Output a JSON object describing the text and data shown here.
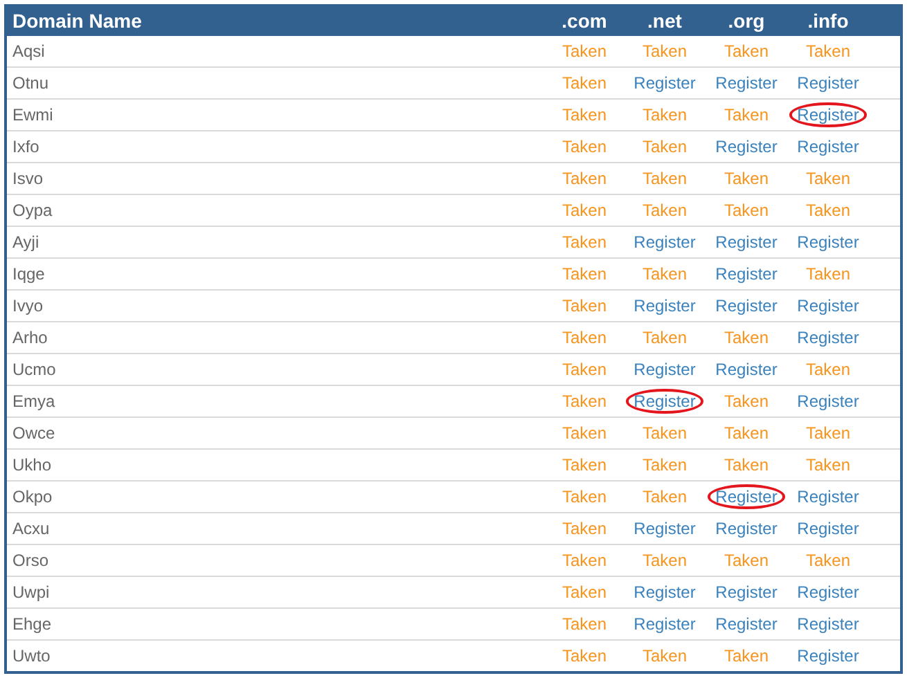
{
  "table": {
    "columns": [
      "Domain Name",
      ".com",
      ".net",
      ".org",
      ".info"
    ],
    "rows": [
      [
        {
          "text": "Aqsi",
          "kind": "domain"
        },
        {
          "text": "Taken",
          "kind": "taken",
          "circled": false
        },
        {
          "text": "Taken",
          "kind": "taken",
          "circled": false
        },
        {
          "text": "Taken",
          "kind": "taken",
          "circled": false
        },
        {
          "text": "Taken",
          "kind": "taken",
          "circled": false
        }
      ],
      [
        {
          "text": "Otnu",
          "kind": "domain"
        },
        {
          "text": "Taken",
          "kind": "taken",
          "circled": false
        },
        {
          "text": "Register",
          "kind": "register",
          "circled": false
        },
        {
          "text": "Register",
          "kind": "register",
          "circled": false
        },
        {
          "text": "Register",
          "kind": "register",
          "circled": false
        }
      ],
      [
        {
          "text": "Ewmi",
          "kind": "domain"
        },
        {
          "text": "Taken",
          "kind": "taken",
          "circled": false
        },
        {
          "text": "Taken",
          "kind": "taken",
          "circled": false
        },
        {
          "text": "Taken",
          "kind": "taken",
          "circled": false
        },
        {
          "text": "Register",
          "kind": "register",
          "circled": true
        }
      ],
      [
        {
          "text": "Ixfo",
          "kind": "domain"
        },
        {
          "text": "Taken",
          "kind": "taken",
          "circled": false
        },
        {
          "text": "Taken",
          "kind": "taken",
          "circled": false
        },
        {
          "text": "Register",
          "kind": "register",
          "circled": false
        },
        {
          "text": "Register",
          "kind": "register",
          "circled": false
        }
      ],
      [
        {
          "text": "Isvo",
          "kind": "domain"
        },
        {
          "text": "Taken",
          "kind": "taken",
          "circled": false
        },
        {
          "text": "Taken",
          "kind": "taken",
          "circled": false
        },
        {
          "text": "Taken",
          "kind": "taken",
          "circled": false
        },
        {
          "text": "Taken",
          "kind": "taken",
          "circled": false
        }
      ],
      [
        {
          "text": "Oypa",
          "kind": "domain"
        },
        {
          "text": "Taken",
          "kind": "taken",
          "circled": false
        },
        {
          "text": "Taken",
          "kind": "taken",
          "circled": false
        },
        {
          "text": "Taken",
          "kind": "taken",
          "circled": false
        },
        {
          "text": "Taken",
          "kind": "taken",
          "circled": false
        }
      ],
      [
        {
          "text": "Ayji",
          "kind": "domain"
        },
        {
          "text": "Taken",
          "kind": "taken",
          "circled": false
        },
        {
          "text": "Register",
          "kind": "register",
          "circled": false
        },
        {
          "text": "Register",
          "kind": "register",
          "circled": false
        },
        {
          "text": "Register",
          "kind": "register",
          "circled": false
        }
      ],
      [
        {
          "text": "Iqge",
          "kind": "domain"
        },
        {
          "text": "Taken",
          "kind": "taken",
          "circled": false
        },
        {
          "text": "Taken",
          "kind": "taken",
          "circled": false
        },
        {
          "text": "Register",
          "kind": "register",
          "circled": false
        },
        {
          "text": "Taken",
          "kind": "taken",
          "circled": false
        }
      ],
      [
        {
          "text": "Ivyo",
          "kind": "domain"
        },
        {
          "text": "Taken",
          "kind": "taken",
          "circled": false
        },
        {
          "text": "Register",
          "kind": "register",
          "circled": false
        },
        {
          "text": "Register",
          "kind": "register",
          "circled": false
        },
        {
          "text": "Register",
          "kind": "register",
          "circled": false
        }
      ],
      [
        {
          "text": "Arho",
          "kind": "domain"
        },
        {
          "text": "Taken",
          "kind": "taken",
          "circled": false
        },
        {
          "text": "Taken",
          "kind": "taken",
          "circled": false
        },
        {
          "text": "Taken",
          "kind": "taken",
          "circled": false
        },
        {
          "text": "Register",
          "kind": "register",
          "circled": false
        }
      ],
      [
        {
          "text": "Ucmo",
          "kind": "domain"
        },
        {
          "text": "Taken",
          "kind": "taken",
          "circled": false
        },
        {
          "text": "Register",
          "kind": "register",
          "circled": false
        },
        {
          "text": "Register",
          "kind": "register",
          "circled": false
        },
        {
          "text": "Taken",
          "kind": "taken",
          "circled": false
        }
      ],
      [
        {
          "text": "Emya",
          "kind": "domain"
        },
        {
          "text": "Taken",
          "kind": "taken",
          "circled": false
        },
        {
          "text": "Register",
          "kind": "register",
          "circled": true
        },
        {
          "text": "Taken",
          "kind": "taken",
          "circled": false
        },
        {
          "text": "Register",
          "kind": "register",
          "circled": false
        }
      ],
      [
        {
          "text": "Owce",
          "kind": "domain"
        },
        {
          "text": "Taken",
          "kind": "taken",
          "circled": false
        },
        {
          "text": "Taken",
          "kind": "taken",
          "circled": false
        },
        {
          "text": "Taken",
          "kind": "taken",
          "circled": false
        },
        {
          "text": "Taken",
          "kind": "taken",
          "circled": false
        }
      ],
      [
        {
          "text": "Ukho",
          "kind": "domain"
        },
        {
          "text": "Taken",
          "kind": "taken",
          "circled": false
        },
        {
          "text": "Taken",
          "kind": "taken",
          "circled": false
        },
        {
          "text": "Taken",
          "kind": "taken",
          "circled": false
        },
        {
          "text": "Taken",
          "kind": "taken",
          "circled": false
        }
      ],
      [
        {
          "text": "Okpo",
          "kind": "domain"
        },
        {
          "text": "Taken",
          "kind": "taken",
          "circled": false
        },
        {
          "text": "Taken",
          "kind": "taken",
          "circled": false
        },
        {
          "text": "Register",
          "kind": "register",
          "circled": true
        },
        {
          "text": "Register",
          "kind": "register",
          "circled": false
        }
      ],
      [
        {
          "text": "Acxu",
          "kind": "domain"
        },
        {
          "text": "Taken",
          "kind": "taken",
          "circled": false
        },
        {
          "text": "Register",
          "kind": "register",
          "circled": false
        },
        {
          "text": "Register",
          "kind": "register",
          "circled": false
        },
        {
          "text": "Register",
          "kind": "register",
          "circled": false
        }
      ],
      [
        {
          "text": "Orso",
          "kind": "domain"
        },
        {
          "text": "Taken",
          "kind": "taken",
          "circled": false
        },
        {
          "text": "Taken",
          "kind": "taken",
          "circled": false
        },
        {
          "text": "Taken",
          "kind": "taken",
          "circled": false
        },
        {
          "text": "Taken",
          "kind": "taken",
          "circled": false
        }
      ],
      [
        {
          "text": "Uwpi",
          "kind": "domain"
        },
        {
          "text": "Taken",
          "kind": "taken",
          "circled": false
        },
        {
          "text": "Register",
          "kind": "register",
          "circled": false
        },
        {
          "text": "Register",
          "kind": "register",
          "circled": false
        },
        {
          "text": "Register",
          "kind": "register",
          "circled": false
        }
      ],
      [
        {
          "text": "Ehge",
          "kind": "domain"
        },
        {
          "text": "Taken",
          "kind": "taken",
          "circled": false
        },
        {
          "text": "Register",
          "kind": "register",
          "circled": false
        },
        {
          "text": "Register",
          "kind": "register",
          "circled": false
        },
        {
          "text": "Register",
          "kind": "register",
          "circled": false
        }
      ],
      [
        {
          "text": "Uwto",
          "kind": "domain"
        },
        {
          "text": "Taken",
          "kind": "taken",
          "circled": false
        },
        {
          "text": "Taken",
          "kind": "taken",
          "circled": false
        },
        {
          "text": "Taken",
          "kind": "taken",
          "circled": false
        },
        {
          "text": "Register",
          "kind": "register",
          "circled": false
        }
      ]
    ]
  }
}
